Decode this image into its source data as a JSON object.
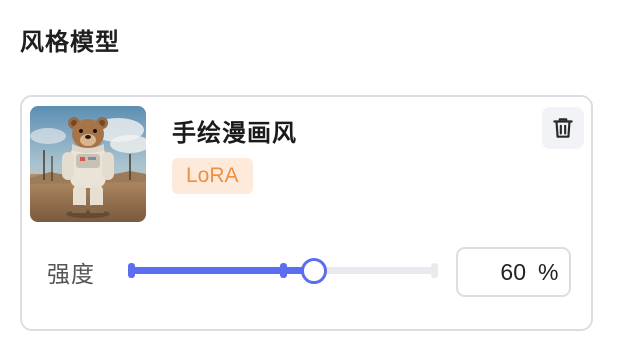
{
  "section": {
    "title": "风格模型"
  },
  "model": {
    "name": "手绘漫画风",
    "type_badge": "LoRA",
    "thumbnail": "astronaut-bear-image",
    "delete_icon": "trash-icon"
  },
  "strength": {
    "label": "强度",
    "value": "60",
    "unit": "%",
    "fraction": 0.6,
    "tick_fraction": 0.5
  },
  "colors": {
    "accent": "#5b6ef0",
    "badge_bg": "#fdeadb",
    "badge_text": "#ee8f41",
    "track": "#e9e9ef",
    "border": "#dcdde2"
  }
}
